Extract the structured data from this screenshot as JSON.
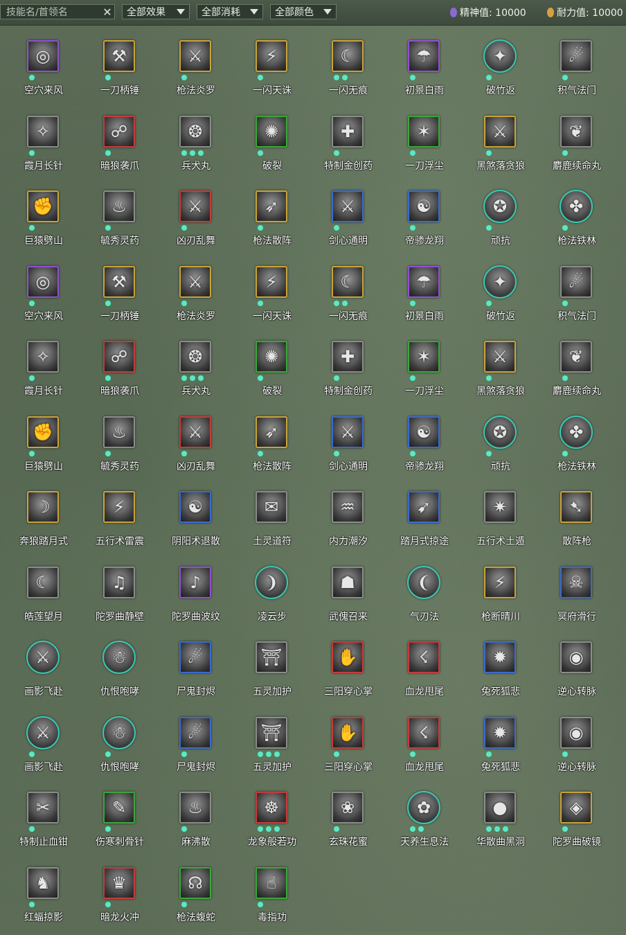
{
  "toolbar": {
    "search_placeholder": "技能名/首领名",
    "clear_icon": "close-icon",
    "filters": [
      {
        "label": "全部效果",
        "icon": "chevron-down-icon"
      },
      {
        "label": "全部消耗",
        "icon": "chevron-down-icon"
      },
      {
        "label": "全部颜色",
        "icon": "chevron-down-icon"
      }
    ],
    "spirit": {
      "label": "精神值: 10000",
      "color": "#8a6ad0"
    },
    "durability": {
      "label": "耐力值: 10000",
      "color": "#d9a040"
    }
  },
  "colors": {
    "gold": "#c9a33a",
    "purple": "#9050d0",
    "red": "#c83a3a",
    "green": "#3aa83a",
    "blue": "#3a6ad0",
    "teal": "#3ac8b0",
    "gray": "#8a8e8a"
  },
  "skills": [
    {
      "name": "空穴来风",
      "border": "purple",
      "dots": 1,
      "shape": "square",
      "glyph": "◎"
    },
    {
      "name": "一刀柄锤",
      "border": "gold",
      "dots": 1,
      "shape": "square",
      "glyph": "⚒"
    },
    {
      "name": "枪法炎罗",
      "border": "gold",
      "dots": 1,
      "shape": "square",
      "glyph": "⚔"
    },
    {
      "name": "一闪天诛",
      "border": "gold",
      "dots": 1,
      "shape": "square",
      "glyph": "⚡"
    },
    {
      "name": "一闪无痕",
      "border": "gold",
      "dots": 2,
      "shape": "square",
      "glyph": "☾"
    },
    {
      "name": "初景白雨",
      "border": "purple",
      "dots": 1,
      "shape": "square",
      "glyph": "☂"
    },
    {
      "name": "破竹返",
      "border": "teal",
      "dots": 1,
      "shape": "round",
      "glyph": "✦"
    },
    {
      "name": "积气法门",
      "border": "gray",
      "dots": 1,
      "shape": "square",
      "glyph": "☄"
    },
    {
      "name": "霞月长针",
      "border": "gray",
      "dots": 1,
      "shape": "square",
      "glyph": "✧"
    },
    {
      "name": "暗狼袭爪",
      "border": "red",
      "dots": 1,
      "shape": "square",
      "glyph": "☍"
    },
    {
      "name": "兵犬丸",
      "border": "gray",
      "dots": 3,
      "shape": "square",
      "glyph": "❂"
    },
    {
      "name": "破裂",
      "border": "green",
      "dots": 1,
      "shape": "square",
      "glyph": "✺"
    },
    {
      "name": "特制金创药",
      "border": "gray",
      "dots": 1,
      "shape": "square",
      "glyph": "✚"
    },
    {
      "name": "一刀浮尘",
      "border": "green",
      "dots": 1,
      "shape": "square",
      "glyph": "✶"
    },
    {
      "name": "黑煞落贪狼",
      "border": "gold",
      "dots": 1,
      "shape": "square",
      "glyph": "⚔"
    },
    {
      "name": "麝鹿续命丸",
      "border": "gray",
      "dots": 1,
      "shape": "square",
      "glyph": "❦"
    },
    {
      "name": "巨猿劈山",
      "border": "gold",
      "dots": 1,
      "shape": "square",
      "glyph": "✊"
    },
    {
      "name": "毓秀灵药",
      "border": "gray",
      "dots": 1,
      "shape": "square",
      "glyph": "♨"
    },
    {
      "name": "凶刃乱舞",
      "border": "red",
      "dots": 1,
      "shape": "square",
      "glyph": "⚔"
    },
    {
      "name": "枪法散阵",
      "border": "gold",
      "dots": 1,
      "shape": "square",
      "glyph": "➶"
    },
    {
      "name": "剑心通明",
      "border": "blue",
      "dots": 1,
      "shape": "square",
      "glyph": "⚔"
    },
    {
      "name": "帝骖龙翔",
      "border": "blue",
      "dots": 1,
      "shape": "square",
      "glyph": "☯"
    },
    {
      "name": "顽抗",
      "border": "teal",
      "dots": 1,
      "shape": "round",
      "glyph": "✪"
    },
    {
      "name": "枪法铁林",
      "border": "teal",
      "dots": 1,
      "shape": "round",
      "glyph": "✤"
    },
    {
      "name": "空穴来风",
      "border": "purple",
      "dots": 1,
      "shape": "square",
      "glyph": "◎"
    },
    {
      "name": "一刀柄锤",
      "border": "gold",
      "dots": 1,
      "shape": "square",
      "glyph": "⚒"
    },
    {
      "name": "枪法炎罗",
      "border": "gold",
      "dots": 1,
      "shape": "square",
      "glyph": "⚔"
    },
    {
      "name": "一闪天诛",
      "border": "gold",
      "dots": 1,
      "shape": "square",
      "glyph": "⚡"
    },
    {
      "name": "一闪无痕",
      "border": "gold",
      "dots": 2,
      "shape": "square",
      "glyph": "☾"
    },
    {
      "name": "初景白雨",
      "border": "purple",
      "dots": 1,
      "shape": "square",
      "glyph": "☂"
    },
    {
      "name": "破竹返",
      "border": "teal",
      "dots": 1,
      "shape": "round",
      "glyph": "✦"
    },
    {
      "name": "积气法门",
      "border": "gray",
      "dots": 1,
      "shape": "square",
      "glyph": "☄"
    },
    {
      "name": "霞月长针",
      "border": "gray",
      "dots": 1,
      "shape": "square",
      "glyph": "✧"
    },
    {
      "name": "暗狼袭爪",
      "border": "red",
      "dots": 1,
      "shape": "square",
      "glyph": "☍"
    },
    {
      "name": "兵犬丸",
      "border": "gray",
      "dots": 3,
      "shape": "square",
      "glyph": "❂"
    },
    {
      "name": "破裂",
      "border": "green",
      "dots": 1,
      "shape": "square",
      "glyph": "✺"
    },
    {
      "name": "特制金创药",
      "border": "gray",
      "dots": 1,
      "shape": "square",
      "glyph": "✚"
    },
    {
      "name": "一刀浮尘",
      "border": "green",
      "dots": 1,
      "shape": "square",
      "glyph": "✶"
    },
    {
      "name": "黑煞落贪狼",
      "border": "gold",
      "dots": 1,
      "shape": "square",
      "glyph": "⚔"
    },
    {
      "name": "麝鹿续命丸",
      "border": "gray",
      "dots": 1,
      "shape": "square",
      "glyph": "❦"
    },
    {
      "name": "巨猿劈山",
      "border": "gold",
      "dots": 1,
      "shape": "square",
      "glyph": "✊"
    },
    {
      "name": "毓秀灵药",
      "border": "gray",
      "dots": 1,
      "shape": "square",
      "glyph": "♨"
    },
    {
      "name": "凶刃乱舞",
      "border": "red",
      "dots": 1,
      "shape": "square",
      "glyph": "⚔"
    },
    {
      "name": "枪法散阵",
      "border": "gold",
      "dots": 1,
      "shape": "square",
      "glyph": "➶"
    },
    {
      "name": "剑心通明",
      "border": "blue",
      "dots": 1,
      "shape": "square",
      "glyph": "⚔"
    },
    {
      "name": "帝骖龙翔",
      "border": "blue",
      "dots": 1,
      "shape": "square",
      "glyph": "☯"
    },
    {
      "name": "顽抗",
      "border": "teal",
      "dots": 1,
      "shape": "round",
      "glyph": "✪"
    },
    {
      "name": "枪法铁林",
      "border": "teal",
      "dots": 1,
      "shape": "round",
      "glyph": "✤"
    },
    {
      "name": "奔狼踏月式",
      "border": "gold",
      "dots": 0,
      "shape": "square",
      "glyph": "☽"
    },
    {
      "name": "五行术雷震",
      "border": "gold",
      "dots": 0,
      "shape": "square",
      "glyph": "⚡"
    },
    {
      "name": "阴阳术退散",
      "border": "blue",
      "dots": 0,
      "shape": "square",
      "glyph": "☯"
    },
    {
      "name": "土灵道符",
      "border": "gray",
      "dots": 0,
      "shape": "square",
      "glyph": "✉"
    },
    {
      "name": "内力潮汐",
      "border": "gray",
      "dots": 0,
      "shape": "square",
      "glyph": "♒"
    },
    {
      "name": "踏月式掠途",
      "border": "blue",
      "dots": 0,
      "shape": "square",
      "glyph": "➹"
    },
    {
      "name": "五行术土遁",
      "border": "gray",
      "dots": 0,
      "shape": "square",
      "glyph": "✷"
    },
    {
      "name": "散阵枪",
      "border": "gold",
      "dots": 0,
      "shape": "square",
      "glyph": "➷"
    },
    {
      "name": "皓莲望月",
      "border": "gray",
      "dots": 0,
      "shape": "square",
      "glyph": "☾"
    },
    {
      "name": "陀罗曲静壁",
      "border": "gray",
      "dots": 0,
      "shape": "square",
      "glyph": "♫"
    },
    {
      "name": "陀罗曲波纹",
      "border": "purple",
      "dots": 0,
      "shape": "square",
      "glyph": "♪"
    },
    {
      "name": "凌云步",
      "border": "teal",
      "dots": 0,
      "shape": "round",
      "glyph": "❩"
    },
    {
      "name": "武傀召来",
      "border": "gray",
      "dots": 0,
      "shape": "square",
      "glyph": "☗"
    },
    {
      "name": "气刃法",
      "border": "teal",
      "dots": 0,
      "shape": "round",
      "glyph": "❨"
    },
    {
      "name": "枪断晴川",
      "border": "gold",
      "dots": 0,
      "shape": "square",
      "glyph": "⚡"
    },
    {
      "name": "冥府滑行",
      "border": "blue",
      "dots": 0,
      "shape": "square",
      "glyph": "☠"
    },
    {
      "name": "画影飞赴",
      "border": "teal",
      "dots": 0,
      "shape": "round",
      "glyph": "⚔"
    },
    {
      "name": "仇恨咆哮",
      "border": "teal",
      "dots": 0,
      "shape": "round",
      "glyph": "☃"
    },
    {
      "name": "尸鬼封烬",
      "border": "blue",
      "dots": 0,
      "shape": "square",
      "glyph": "☄"
    },
    {
      "name": "五灵加护",
      "border": "gray",
      "dots": 0,
      "shape": "square",
      "glyph": "⛩"
    },
    {
      "name": "三阳穿心掌",
      "border": "red",
      "dots": 0,
      "shape": "square",
      "glyph": "✋"
    },
    {
      "name": "血龙甩尾",
      "border": "red",
      "dots": 0,
      "shape": "square",
      "glyph": "☇"
    },
    {
      "name": "兔死狐悲",
      "border": "blue",
      "dots": 0,
      "shape": "square",
      "glyph": "✹"
    },
    {
      "name": "逆心转脉",
      "border": "gray",
      "dots": 0,
      "shape": "square",
      "glyph": "◉"
    },
    {
      "name": "画影飞赴",
      "border": "teal",
      "dots": 1,
      "shape": "round",
      "glyph": "⚔"
    },
    {
      "name": "仇恨咆哮",
      "border": "teal",
      "dots": 1,
      "shape": "round",
      "glyph": "☃"
    },
    {
      "name": "尸鬼封烬",
      "border": "blue",
      "dots": 1,
      "shape": "square",
      "glyph": "☄"
    },
    {
      "name": "五灵加护",
      "border": "gray",
      "dots": 3,
      "shape": "square",
      "glyph": "⛩"
    },
    {
      "name": "三阳穿心掌",
      "border": "red",
      "dots": 1,
      "shape": "square",
      "glyph": "✋"
    },
    {
      "name": "血龙甩尾",
      "border": "red",
      "dots": 1,
      "shape": "square",
      "glyph": "☇"
    },
    {
      "name": "兔死狐悲",
      "border": "blue",
      "dots": 1,
      "shape": "square",
      "glyph": "✹"
    },
    {
      "name": "逆心转脉",
      "border": "gray",
      "dots": 1,
      "shape": "square",
      "glyph": "◉"
    },
    {
      "name": "特制止血钳",
      "border": "gray",
      "dots": 1,
      "shape": "square",
      "glyph": "✂"
    },
    {
      "name": "伤寒刺骨针",
      "border": "green",
      "dots": 1,
      "shape": "square",
      "glyph": "✎"
    },
    {
      "name": "麻沸散",
      "border": "gray",
      "dots": 1,
      "shape": "square",
      "glyph": "♨"
    },
    {
      "name": "龙象般若功",
      "border": "red",
      "dots": 3,
      "shape": "square",
      "glyph": "☸"
    },
    {
      "name": "玄珠花蜜",
      "border": "gray",
      "dots": 1,
      "shape": "square",
      "glyph": "❀"
    },
    {
      "name": "天养生息法",
      "border": "teal",
      "dots": 2,
      "shape": "round",
      "glyph": "✿"
    },
    {
      "name": "华散曲黑洞",
      "border": "gray",
      "dots": 3,
      "shape": "square",
      "glyph": "●"
    },
    {
      "name": "陀罗曲破镜",
      "border": "gold",
      "dots": 1,
      "shape": "square",
      "glyph": "◈"
    },
    {
      "name": "红蝠掠影",
      "border": "gray",
      "dots": 1,
      "shape": "square",
      "glyph": "♞"
    },
    {
      "name": "暗龙火冲",
      "border": "red",
      "dots": 1,
      "shape": "square",
      "glyph": "♛"
    },
    {
      "name": "枪法蝮蛇",
      "border": "green",
      "dots": 1,
      "shape": "square",
      "glyph": "☊"
    },
    {
      "name": "毒指功",
      "border": "green",
      "dots": 1,
      "shape": "square",
      "glyph": "☝"
    }
  ]
}
